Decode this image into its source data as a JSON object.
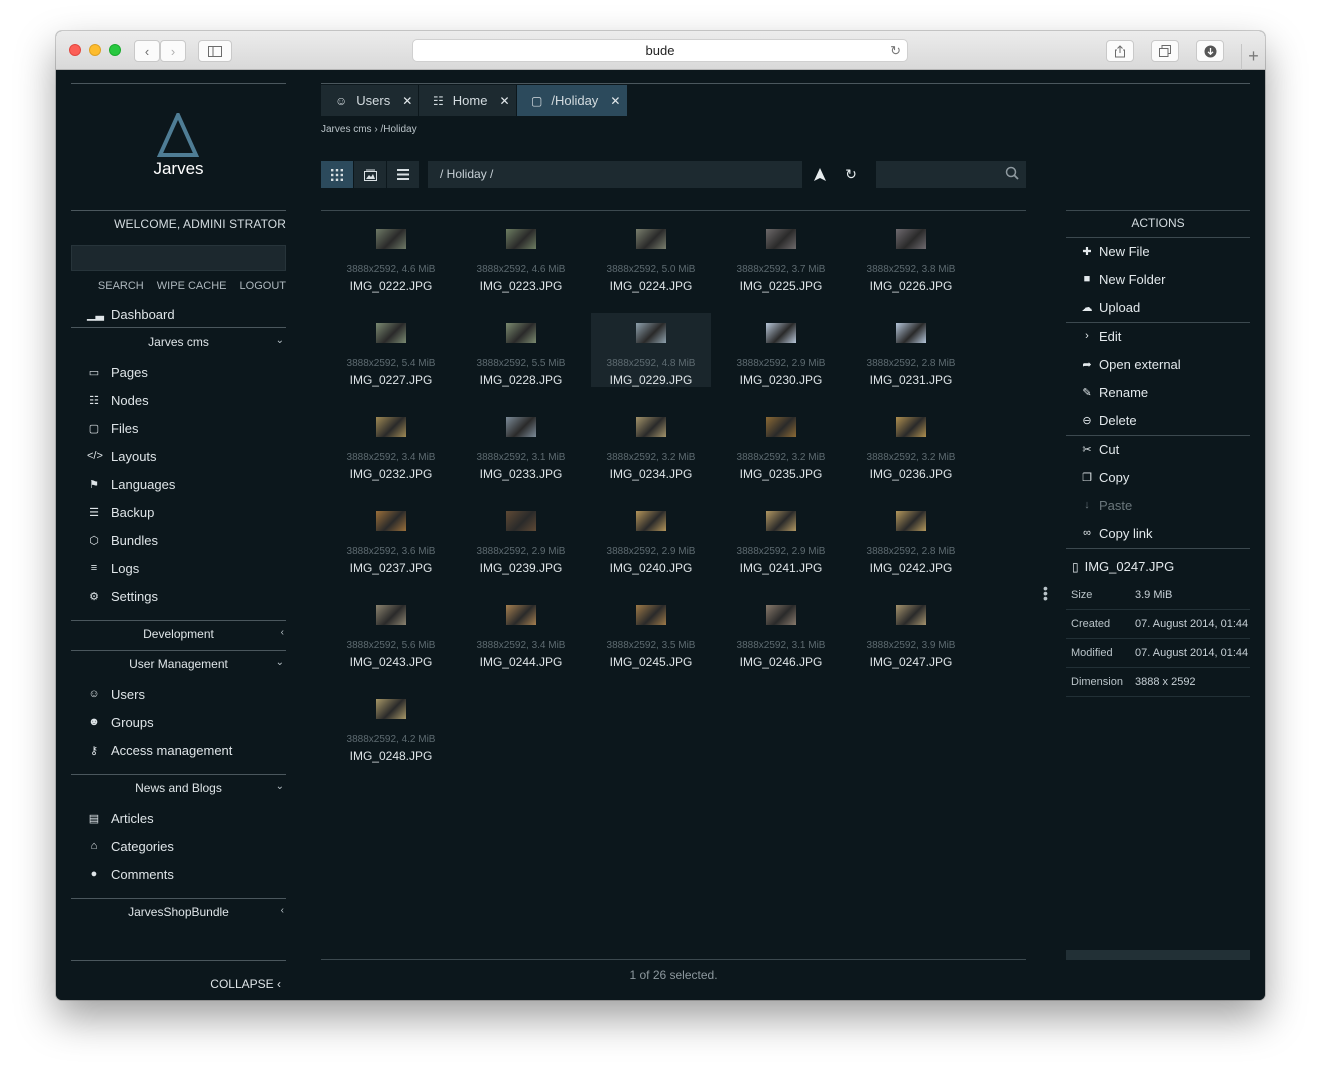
{
  "browser": {
    "url": "bude"
  },
  "sidebar": {
    "logo_text": "Jarves",
    "welcome": "WELCOME, ADMINI STRATOR",
    "links": [
      "SEARCH",
      "WIPE CACHE",
      "LOGOUT"
    ],
    "dashboard": "Dashboard",
    "groups": [
      {
        "title": "Jarves cms",
        "expanded": true,
        "items": [
          "Pages",
          "Nodes",
          "Files",
          "Layouts",
          "Languages",
          "Backup",
          "Bundles",
          "Logs",
          "Settings"
        ]
      },
      {
        "title": "Development",
        "expanded": false,
        "items": []
      },
      {
        "title": "User Management",
        "expanded": true,
        "items": [
          "Users",
          "Groups",
          "Access management"
        ]
      },
      {
        "title": "News and Blogs",
        "expanded": true,
        "items": [
          "Articles",
          "Categories",
          "Comments"
        ]
      },
      {
        "title": "JarvesShopBundle",
        "expanded": false,
        "items": []
      }
    ],
    "collapse": "COLLAPSE"
  },
  "tabs": [
    {
      "label": "Users",
      "icon": "user-icon",
      "active": false
    },
    {
      "label": "Home",
      "icon": "sitemap-icon",
      "active": false
    },
    {
      "label": "/Holiday",
      "icon": "folder-icon",
      "active": true
    }
  ],
  "breadcrumb": "Jarves cms › /Holiday",
  "toolbar": {
    "path": "/  Holiday  /",
    "view_modes": [
      "grid-view",
      "image-view",
      "list-view"
    ]
  },
  "files": [
    {
      "meta": "3888x2592, 4.6 MiB",
      "name": "IMG_0222.JPG",
      "color": "#6f7a67",
      "selected": false
    },
    {
      "meta": "3888x2592, 4.6 MiB",
      "name": "IMG_0223.JPG",
      "color": "#6e7e62",
      "selected": false
    },
    {
      "meta": "3888x2592, 5.0 MiB",
      "name": "IMG_0224.JPG",
      "color": "#7a7f6e",
      "selected": false
    },
    {
      "meta": "3888x2592, 3.7 MiB",
      "name": "IMG_0225.JPG",
      "color": "#6e6a6b",
      "selected": false
    },
    {
      "meta": "3888x2592, 3.8 MiB",
      "name": "IMG_0226.JPG",
      "color": "#6f6b70",
      "selected": false
    },
    {
      "meta": "3888x2592, 5.4 MiB",
      "name": "IMG_0227.JPG",
      "color": "#7b8a72",
      "selected": false
    },
    {
      "meta": "3888x2592, 5.5 MiB",
      "name": "IMG_0228.JPG",
      "color": "#7c8b70",
      "selected": false
    },
    {
      "meta": "3888x2592, 4.8 MiB",
      "name": "IMG_0229.JPG",
      "color": "#8ea1ad",
      "selected": true
    },
    {
      "meta": "3888x2592, 2.9 MiB",
      "name": "IMG_0230.JPG",
      "color": "#b8c7d9",
      "selected": false
    },
    {
      "meta": "3888x2592, 2.8 MiB",
      "name": "IMG_0231.JPG",
      "color": "#b5c6da",
      "selected": false
    },
    {
      "meta": "3888x2592, 3.4 MiB",
      "name": "IMG_0232.JPG",
      "color": "#a08a55",
      "selected": false
    },
    {
      "meta": "3888x2592, 3.1 MiB",
      "name": "IMG_0233.JPG",
      "color": "#7d8c99",
      "selected": false
    },
    {
      "meta": "3888x2592, 3.2 MiB",
      "name": "IMG_0234.JPG",
      "color": "#a4946b",
      "selected": false
    },
    {
      "meta": "3888x2592, 3.2 MiB",
      "name": "IMG_0235.JPG",
      "color": "#8c6a35",
      "selected": false
    },
    {
      "meta": "3888x2592, 3.2 MiB",
      "name": "IMG_0236.JPG",
      "color": "#b09050",
      "selected": false
    },
    {
      "meta": "3888x2592, 3.6 MiB",
      "name": "IMG_0237.JPG",
      "color": "#9a6f3a",
      "selected": false
    },
    {
      "meta": "3888x2592, 2.9 MiB",
      "name": "IMG_0239.JPG",
      "color": "#5f4a35",
      "selected": false
    },
    {
      "meta": "3888x2592, 2.9 MiB",
      "name": "IMG_0240.JPG",
      "color": "#b4955a",
      "selected": false
    },
    {
      "meta": "3888x2592, 2.9 MiB",
      "name": "IMG_0241.JPG",
      "color": "#b29862",
      "selected": false
    },
    {
      "meta": "3888x2592, 2.8 MiB",
      "name": "IMG_0242.JPG",
      "color": "#b4985c",
      "selected": false
    },
    {
      "meta": "3888x2592, 5.6 MiB",
      "name": "IMG_0243.JPG",
      "color": "#8c8470",
      "selected": false
    },
    {
      "meta": "3888x2592, 3.4 MiB",
      "name": "IMG_0244.JPG",
      "color": "#a68050",
      "selected": false
    },
    {
      "meta": "3888x2592, 3.5 MiB",
      "name": "IMG_0245.JPG",
      "color": "#9e7a48",
      "selected": false
    },
    {
      "meta": "3888x2592, 3.1 MiB",
      "name": "IMG_0246.JPG",
      "color": "#887a6c",
      "selected": false
    },
    {
      "meta": "3888x2592, 3.9 MiB",
      "name": "IMG_0247.JPG",
      "color": "#a6946e",
      "selected": false
    },
    {
      "meta": "3888x2592, 4.2 MiB",
      "name": "IMG_0248.JPG",
      "color": "#a89868",
      "selected": false
    }
  ],
  "status": "1 of 26 selected.",
  "actions": {
    "title": "ACTIONS",
    "items": [
      "New File",
      "New Folder",
      "Upload",
      "Edit",
      "Open external",
      "Rename",
      "Delete",
      "Cut",
      "Copy",
      "Paste",
      "Copy link"
    ],
    "disabled": [
      "Paste"
    ]
  },
  "fileinfo": {
    "name": "IMG_0247.JPG",
    "rows": [
      {
        "key": "Size",
        "value": "3.9 MiB"
      },
      {
        "key": "Created",
        "value": "07. August 2014, 01:44"
      },
      {
        "key": "Modified",
        "value": "07. August 2014, 01:44"
      },
      {
        "key": "Dimension",
        "value": "3888 x 2592"
      }
    ]
  },
  "colors": {
    "background": "#0c171c",
    "panel": "#1d2a30",
    "accent": "#2c4a5c"
  }
}
